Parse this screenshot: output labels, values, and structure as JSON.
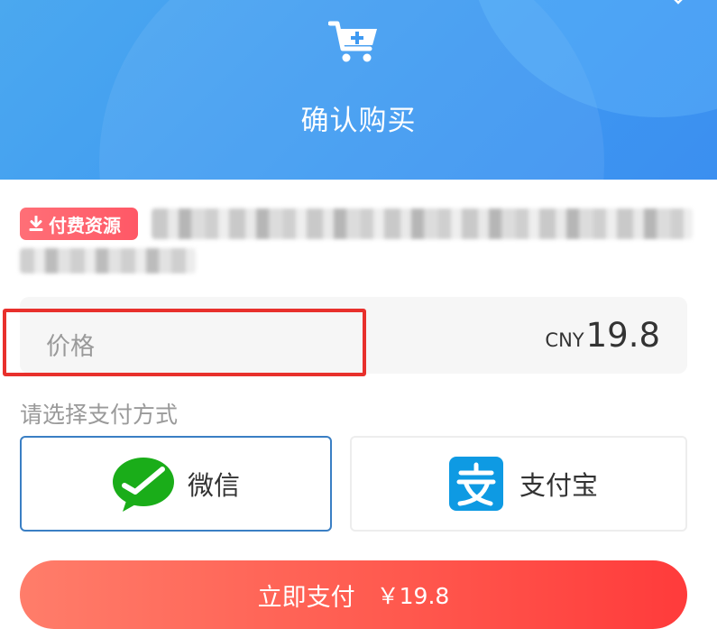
{
  "header": {
    "title": "确认购买",
    "cart_icon": "cart-plus-icon",
    "close_icon": "close-icon",
    "colors": {
      "start": "#4ba8ef",
      "end": "#3b8ff0"
    }
  },
  "resource": {
    "badge_label": "付费资源",
    "badge_icon": "download-icon",
    "badge_color": "#ff5e6b"
  },
  "price": {
    "label": "价格",
    "currency": "CNY",
    "amount": "19.8"
  },
  "payment": {
    "section_label": "请选择支付方式",
    "methods": [
      {
        "label": "微信",
        "icon": "wechat-icon",
        "selected": true,
        "color": "#1aad19"
      },
      {
        "label": "支付宝",
        "icon": "alipay-icon",
        "selected": false,
        "color": "#0e9ae3"
      }
    ]
  },
  "pay_button": {
    "label": "立即支付",
    "amount": "￥19.8",
    "color": "#ff4b45"
  },
  "highlight_color": "#e8302c"
}
